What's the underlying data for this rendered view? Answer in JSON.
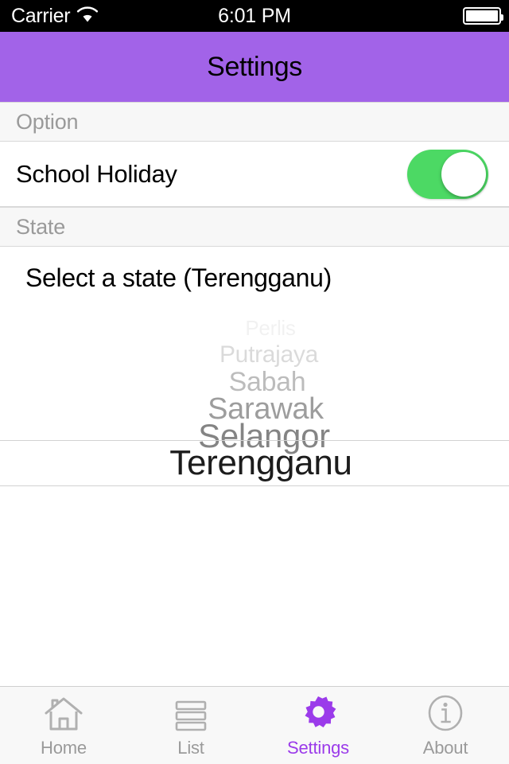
{
  "status_bar": {
    "carrier": "Carrier",
    "wifi_icon": "wifi-icon",
    "time": "6:01 PM",
    "battery_icon": "battery-full-icon"
  },
  "nav_bar": {
    "title": "Settings",
    "background_color": "#a263e8",
    "title_color": "#000000"
  },
  "sections": {
    "option": {
      "header": "Option",
      "row_label": "School Holiday",
      "toggle": {
        "name": "school-holiday-switch",
        "state": "on",
        "on_color": "#4cd964",
        "knob_color": "#ffffff"
      }
    },
    "state": {
      "header": "State",
      "row_label": "Select a state (Terengganu)",
      "selected_value": "Terengganu"
    }
  },
  "picker": {
    "name": "state-picker",
    "selected": "Terengganu",
    "selected_color": "#1c1c1c",
    "items": [
      {
        "label": "Perlis",
        "size": 26,
        "opacity": 0.05,
        "offset": 12
      },
      {
        "label": "Putrajaya",
        "size": 30,
        "opacity": 0.14,
        "offset": 10
      },
      {
        "label": "Sabah",
        "size": 34,
        "opacity": 0.26,
        "offset": 8
      },
      {
        "label": "Sarawak",
        "size": 38,
        "opacity": 0.38,
        "offset": 6
      },
      {
        "label": "Selangor",
        "size": 42,
        "opacity": 0.48,
        "offset": 4
      },
      {
        "label": "Terengganu",
        "size": 44,
        "opacity": 1.0,
        "offset": 0
      }
    ]
  },
  "tab_bar": {
    "active": "Settings",
    "active_color": "#9b3bea",
    "inactive_color": "#9a9a9a",
    "items": [
      {
        "label": "Home",
        "icon": "house-icon",
        "active": false
      },
      {
        "label": "List",
        "icon": "list-icon",
        "active": false
      },
      {
        "label": "Settings",
        "icon": "gear-icon",
        "active": true
      },
      {
        "label": "About",
        "icon": "info-circle-icon",
        "active": false
      }
    ]
  }
}
